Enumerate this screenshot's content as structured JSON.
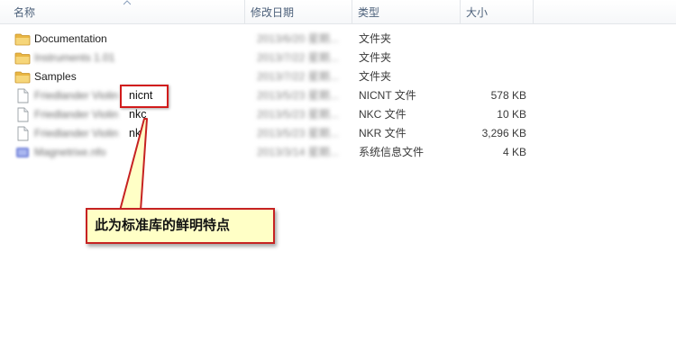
{
  "columns": {
    "name": "名称",
    "date": "修改日期",
    "type": "类型",
    "size": "大小"
  },
  "files": [
    {
      "name": "Documentation",
      "date": "2013/6/20 星期...",
      "type": "文件夹",
      "size": "",
      "icon": "folder-icon",
      "blurred": false
    },
    {
      "name": "Instruments 1.01",
      "date": "2013/7/22 星期...",
      "type": "文件夹",
      "size": "",
      "icon": "folder-icon",
      "blurred": true
    },
    {
      "name": "Samples",
      "date": "2013/7/22 星期...",
      "type": "文件夹",
      "size": "",
      "icon": "folder-icon",
      "blurred": false
    },
    {
      "name": "Friedlander Violin",
      "ext": "nicnt",
      "date": "2013/5/23 星期...",
      "type": "NICNT 文件",
      "size": "578 KB",
      "icon": "file-icon",
      "blurred": true
    },
    {
      "name": "Friedlander Violin",
      "ext": "nkc",
      "date": "2013/5/23 星期...",
      "type": "NKC 文件",
      "size": "10 KB",
      "icon": "file-icon",
      "blurred": true
    },
    {
      "name": "Friedlander Violin",
      "ext": "nkr",
      "date": "2013/5/23 星期...",
      "type": "NKR 文件",
      "size": "3,296 KB",
      "icon": "file-icon",
      "blurred": true
    },
    {
      "name": "Magnetrixe.nfo",
      "date": "2013/3/14 星期...",
      "type": "系统信息文件",
      "size": "4 KB",
      "icon": "info-file-icon",
      "blurred": true
    }
  ],
  "annotation": {
    "text": "此为标准库的鲜明特点",
    "colors": {
      "border": "#c62222",
      "fill": "#ffffc6"
    }
  }
}
